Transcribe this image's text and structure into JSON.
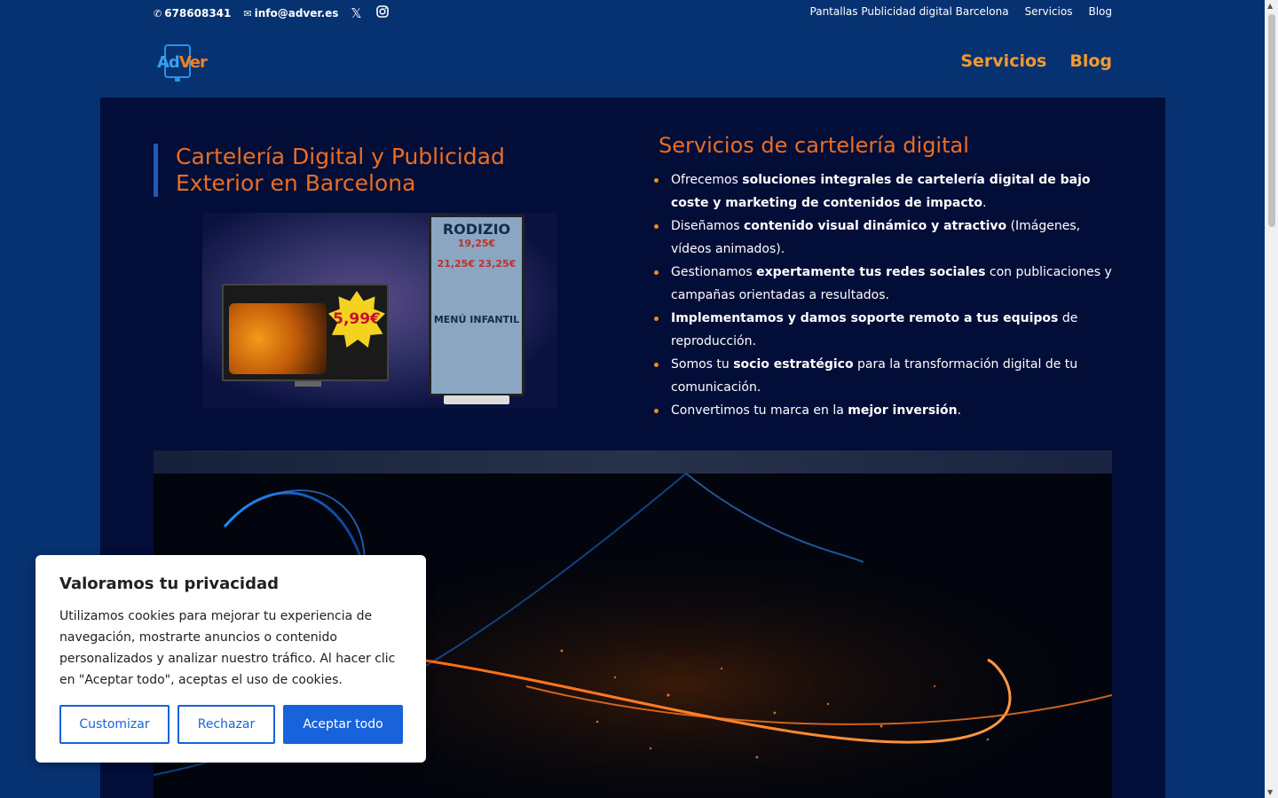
{
  "topbar": {
    "phone": "678608341",
    "email": "info@adver.es",
    "links": [
      "Pantallas Publicidad digital Barcelona",
      "Servicios",
      "Blog"
    ]
  },
  "header": {
    "logo_ad": "Ad",
    "logo_ver": "Ver",
    "nav": [
      "Servicios",
      "Blog"
    ]
  },
  "hero": {
    "title_line1": "Cartelería Digital y Publicidad",
    "title_line2": "Exterior en Barcelona",
    "image": {
      "price": "5,99€",
      "kiosk_title": "RODIZIO",
      "kiosk_price1": "19,25€",
      "kiosk_price2": "21,25€  23,25€",
      "kiosk_menu": "MENÚ INFANTIL"
    }
  },
  "services": {
    "title": "Servicios de cartelería digital",
    "items": [
      {
        "pre": "Ofrecemos ",
        "bold": "soluciones integrales de cartelería digital de bajo coste y marketing de contenidos de impacto",
        "post": "."
      },
      {
        "pre": "Diseñamos ",
        "bold": "contenido visual dinámico y atractivo",
        "post": " (Imágenes, vídeos animados)."
      },
      {
        "pre": "Gestionamos ",
        "bold": "expertamente tus redes sociales",
        "post": " con publicaciones y campañas orientadas a resultados."
      },
      {
        "pre": "",
        "bold": "Implementamos y damos soporte remoto a tus equipos",
        "post": " de reproducción."
      },
      {
        "pre": "Somos tu ",
        "bold": "socio estratégico",
        "post": " para la transformación digital de tu comunicación."
      },
      {
        "pre": "Convertimos tu marca en la ",
        "bold": "mejor inversión",
        "post": "."
      }
    ]
  },
  "cookie": {
    "title": "Valoramos tu privacidad",
    "text": "Utilizamos cookies para mejorar tu experiencia de navegación, mostrarte anuncios o contenido personalizados y analizar nuestro tráfico. Al hacer clic en \"Aceptar todo\", aceptas el uso de cookies.",
    "customize": "Customizar",
    "reject": "Rechazar",
    "accept": "Aceptar todo"
  },
  "colors": {
    "accent_orange": "#ec6d21",
    "header_blue": "#063272",
    "page_dark": "#020d38",
    "button_blue": "#1863dc"
  },
  "icons": [
    "phone-icon",
    "mail-icon",
    "x-twitter-icon",
    "instagram-icon"
  ]
}
